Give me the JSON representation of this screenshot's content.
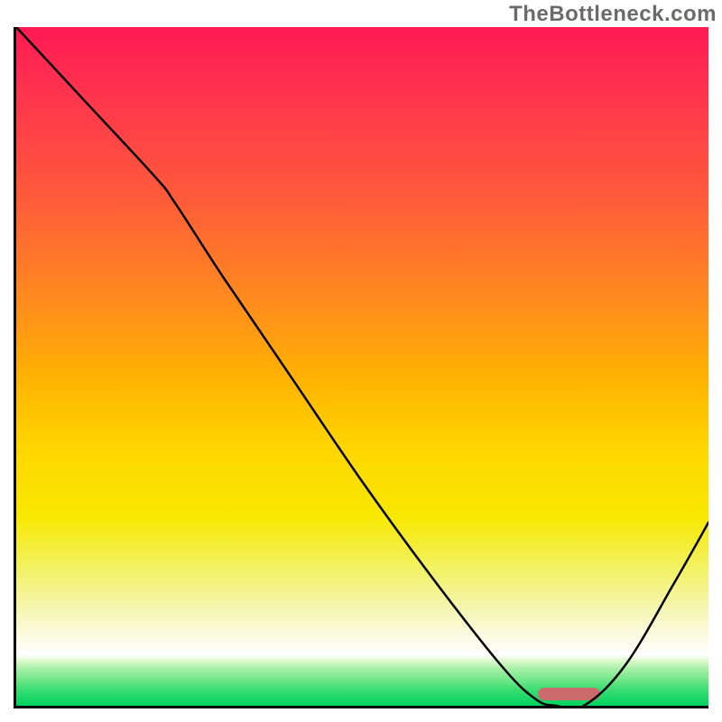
{
  "watermark": "TheBottleneck.com",
  "chart_data": {
    "type": "line",
    "title": "",
    "xlabel": "",
    "ylabel": "",
    "xlim": [
      0,
      100
    ],
    "ylim": [
      0,
      100
    ],
    "grid": false,
    "legend": false,
    "background_gradient": {
      "direction": "vertical",
      "stops": [
        {
          "pos": 0.0,
          "color": "#ff1a52",
          "meaning": "worst"
        },
        {
          "pos": 0.5,
          "color": "#ffb300",
          "meaning": "mid"
        },
        {
          "pos": 0.92,
          "color": "#ffffff",
          "meaning": "near-best"
        },
        {
          "pos": 1.0,
          "color": "#00d25e",
          "meaning": "best"
        }
      ]
    },
    "series": [
      {
        "name": "bottleneck-curve",
        "color": "#000000",
        "x": [
          0,
          10,
          20,
          23,
          30,
          40,
          50,
          60,
          70,
          75,
          78,
          82,
          88,
          95,
          100
        ],
        "y": [
          100,
          89,
          78,
          74,
          63,
          48,
          33,
          19,
          6,
          1,
          0,
          0,
          6,
          18,
          27
        ]
      }
    ],
    "optimal_range": {
      "x_start": 75,
      "x_end": 84,
      "color": "#cc6b6b"
    },
    "annotations": []
  }
}
